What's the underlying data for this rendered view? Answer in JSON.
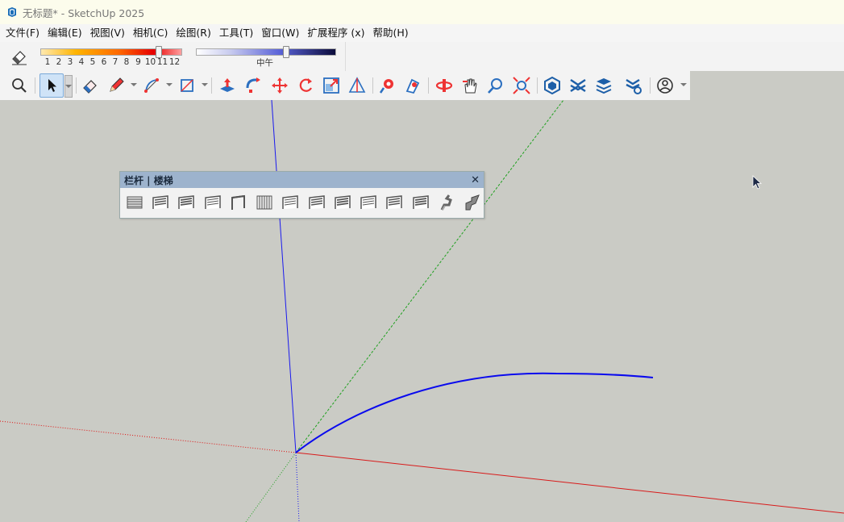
{
  "window": {
    "title": "无标题* - SketchUp 2025"
  },
  "menu": [
    "文件(F)",
    "编辑(E)",
    "视图(V)",
    "相机(C)",
    "绘图(R)",
    "工具(T)",
    "窗口(W)",
    "扩展程序 (x)",
    "帮助(H)"
  ],
  "shadow": {
    "months": [
      "1",
      "2",
      "3",
      "4",
      "5",
      "6",
      "7",
      "8",
      "9",
      "10",
      "11",
      "12"
    ],
    "time_label": "中午",
    "month_position": 0.85,
    "time_position": 0.65,
    "icon": "shadow-eraser-icon"
  },
  "toolbar": {
    "tools": [
      "zoom-search-icon",
      "select-arrow-icon",
      "eraser-icon",
      "pencil-icon",
      "arc-icon",
      "rectangle-icon",
      "push-pull-icon",
      "follow-me-icon",
      "move-icon",
      "rotate-icon",
      "scale-icon",
      "tape-measure-icon",
      "paint-bucket-icon",
      "styles-icon",
      "orbit-icon",
      "pan-icon",
      "zoom-icon",
      "zoom-extents-icon",
      "warehouse-icon",
      "extension-warehouse-icon",
      "layers-icon",
      "extension-manager-icon",
      "account-icon"
    ]
  },
  "railing_panel": {
    "title": "栏杆 | 楼梯",
    "close_label": "✕",
    "tools": [
      "railing-horizontal-icon",
      "railing-frame-icon",
      "railing-bars-icon",
      "railing-rails-icon",
      "railing-post-icon",
      "railing-balusters-icon",
      "railing-vertical-icon",
      "railing-panel-icon",
      "railing-grid-icon",
      "railing-double-icon",
      "railing-cross-icon",
      "railing-louver-icon",
      "stair-spiral-icon",
      "stair-straight-icon"
    ]
  },
  "colors": {
    "background": "#cacbc5",
    "red_axis": "#e01010",
    "green_axis": "#1fa01f",
    "blue_axis": "#1a1aee",
    "curve": "#0a0aee",
    "panel_title_bg": "#9db3cd"
  }
}
